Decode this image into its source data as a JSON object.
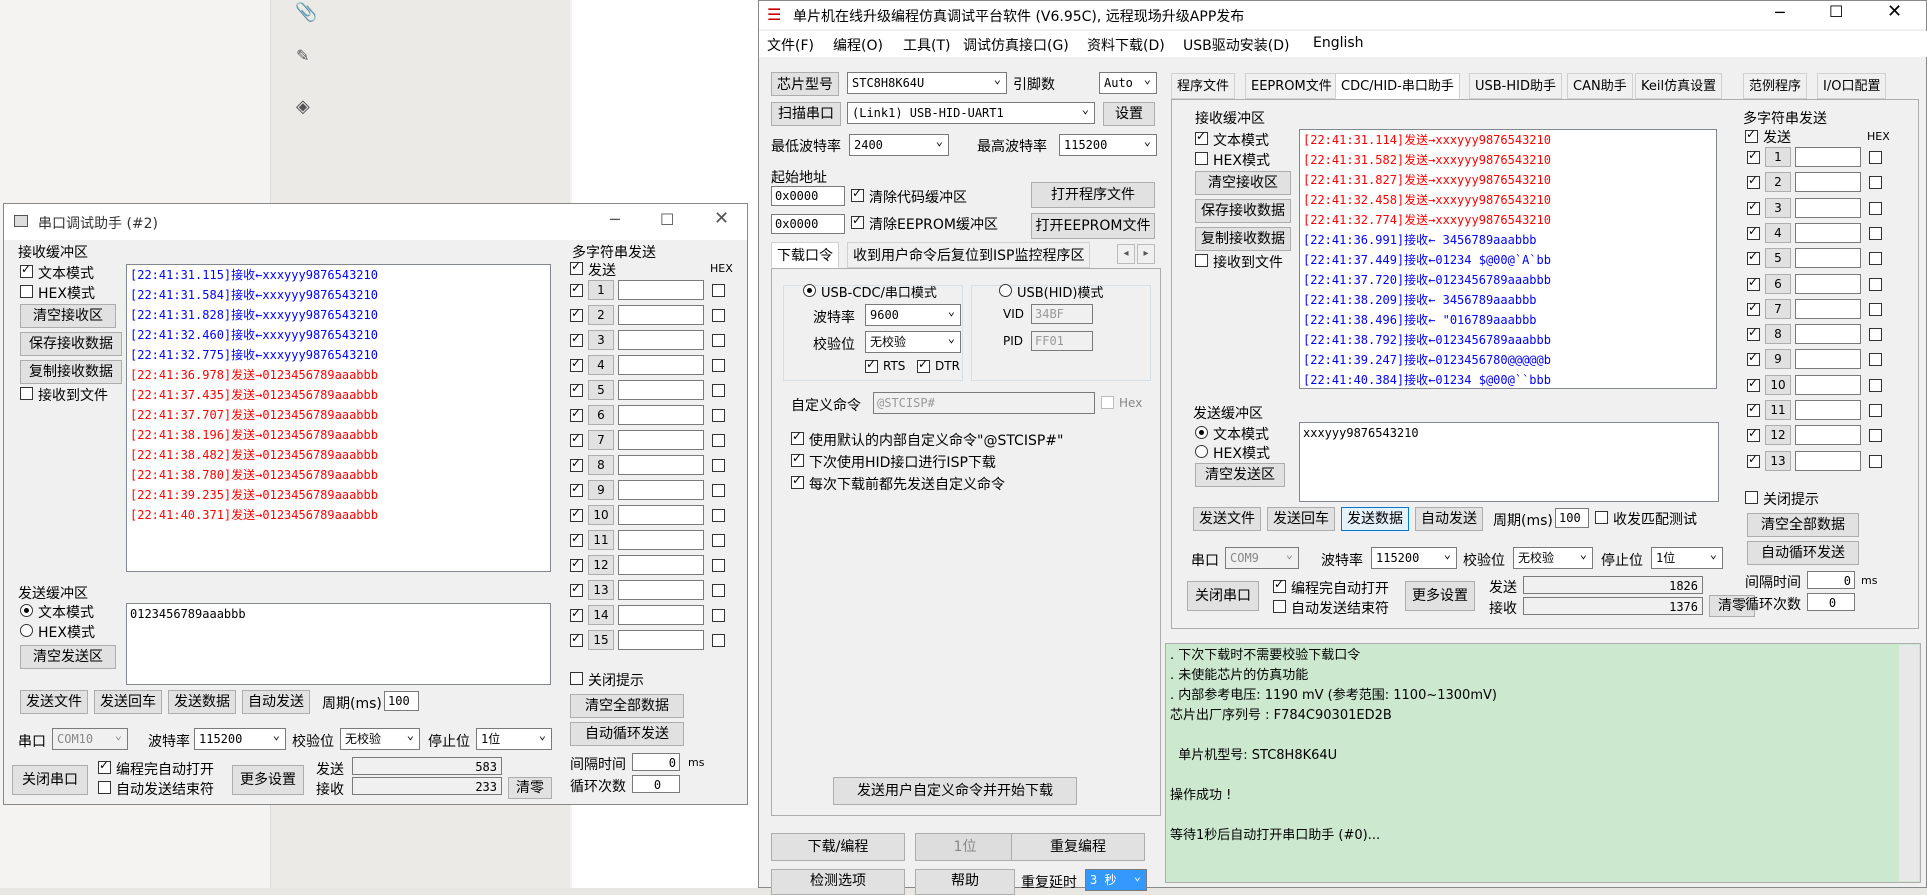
{
  "bg_toolbar": {
    "icons": [
      "paperclip-icon",
      "highlighter-icon",
      "layers-icon"
    ]
  },
  "serial2": {
    "title": "串口调试助手 (#2)",
    "recv_group": "接收缓冲区",
    "text_mode": "文本模式",
    "hex_mode": "HEX模式",
    "clear_recv": "清空接收区",
    "save_recv": "保存接收数据",
    "copy_recv": "复制接收数据",
    "recv_to_file": "接收到文件",
    "log": [
      {
        "t": "[22:41:31.115]接收←xxxyyy9876543210",
        "k": "recv"
      },
      {
        "t": "[22:41:31.584]接收←xxxyyy9876543210",
        "k": "recv"
      },
      {
        "t": "[22:41:31.828]接收←xxxyyy9876543210",
        "k": "recv"
      },
      {
        "t": "[22:41:32.460]接收←xxxyyy9876543210",
        "k": "recv"
      },
      {
        "t": "[22:41:32.775]接收←xxxyyy9876543210",
        "k": "recv"
      },
      {
        "t": "[22:41:36.978]发送→0123456789aaabbb",
        "k": "sent"
      },
      {
        "t": "[22:41:37.435]发送→0123456789aaabbb",
        "k": "sent"
      },
      {
        "t": "[22:41:37.707]发送→0123456789aaabbb",
        "k": "sent"
      },
      {
        "t": "[22:41:38.196]发送→0123456789aaabbb",
        "k": "sent"
      },
      {
        "t": "[22:41:38.482]发送→0123456789aaabbb",
        "k": "sent"
      },
      {
        "t": "[22:41:38.780]发送→0123456789aaabbb",
        "k": "sent"
      },
      {
        "t": "[22:41:39.235]发送→0123456789aaabbb",
        "k": "sent"
      },
      {
        "t": "[22:41:40.371]发送→0123456789aaabbb",
        "k": "sent"
      }
    ],
    "send_group": "发送缓冲区",
    "send_text": "0123456789aaabbb",
    "clear_send": "清空发送区",
    "send_file": "发送文件",
    "send_enter": "发送回车",
    "send_data": "发送数据",
    "auto_send": "自动发送",
    "period_label": "周期(ms)",
    "period": "100",
    "port_label": "串口",
    "port": "COM10",
    "baud_label": "波特率",
    "baud": "115200",
    "parity_label": "校验位",
    "parity": "无校验",
    "stop_label": "停止位",
    "stop": "1位",
    "close_port": "关闭串口",
    "auto_open": "编程完自动打开",
    "auto_end": "自动发送结束符",
    "more": "更多设置",
    "sent_label": "发送",
    "sent_count": "583",
    "recv_label": "接收",
    "recv_count": "233",
    "clear": "清零",
    "multi_title": "多字符串发送",
    "multi_send": "发送",
    "multi_hex": "HEX",
    "multi_rows": [
      "1",
      "2",
      "3",
      "4",
      "5",
      "6",
      "7",
      "8",
      "9",
      "10",
      "11",
      "12",
      "13",
      "14",
      "15"
    ],
    "close_tip": "关闭提示",
    "clear_all": "清空全部数据",
    "auto_loop": "自动循环发送",
    "interval_label": "间隔时间",
    "interval": "0",
    "ms": "ms",
    "loop_label": "循环次数",
    "loop": "0"
  },
  "main": {
    "title": "单片机在线升级编程仿真调试平台软件 (V6.95C), 远程现场升级APP发布",
    "menu": [
      "文件(F)",
      "编程(O)",
      "工具(T)",
      "调试仿真接口(G)",
      "资料下载(D)",
      "USB驱动安装(D)",
      "English"
    ],
    "chip_label": "芯片型号",
    "chip": "STC8H8K64U",
    "pin_label": "引脚数",
    "pin": "Auto",
    "scan": "扫描串口",
    "port": "(Link1) USB-HID-UART1",
    "settings": "设置",
    "min_baud_label": "最低波特率",
    "min_baud": "2400",
    "max_baud_label": "最高波特率",
    "max_baud": "115200",
    "start_addr": "起始地址",
    "addr1": "0x0000",
    "clear_code": "清除代码缓冲区",
    "open_prog": "打开程序文件",
    "addr2": "0x0000",
    "clear_eeprom": "清除EEPROM缓冲区",
    "open_eeprom": "打开EEPROM文件",
    "tabs_left": [
      "下载口令",
      "收到用户命令后复位到ISP监控程序区"
    ],
    "usb_cdc": "USB-CDC/串口模式",
    "usb_hid": "USB(HID)模式",
    "baud_label": "波特率",
    "baud": "9600",
    "vid_label": "VID",
    "vid": "34BF",
    "parity_label": "校验位",
    "parity": "无校验",
    "pid_label": "PID",
    "pid": "FF01",
    "rts": "RTS",
    "dtr": "DTR",
    "custom_label": "自定义命令",
    "custom": "@STCISP#",
    "hex": "Hex",
    "opt1": "使用默认的内部自定义命令\"@STCISP#\"",
    "opt2": "下次使用HID接口进行ISP下载",
    "opt3": "每次下载前都先发送自定义命令",
    "send_custom": "发送用户自定义命令并开始下载",
    "download": "下载/编程",
    "stop": "1位",
    "reprogram": "重复编程",
    "detect": "检测选项",
    "help": "帮助",
    "repeat_delay_label": "重复延时",
    "repeat_delay": "3 秒",
    "tabs_right": [
      "程序文件",
      "EEPROM文件",
      "CDC/HID-串口助手",
      "USB-HID助手",
      "CAN助手",
      "Keil仿真设置",
      "范例程序",
      "I/O口配置"
    ],
    "recv_group": "接收缓冲区",
    "text_mode": "文本模式",
    "hex_mode": "HEX模式",
    "clear_recv": "清空接收区",
    "save_recv": "保存接收数据",
    "copy_recv": "复制接收数据",
    "recv_to_file": "接收到文件",
    "log": [
      {
        "t": "[22:41:31.114]发送→xxxyyy9876543210",
        "k": "sent"
      },
      {
        "t": "[22:41:31.582]发送→xxxyyy9876543210",
        "k": "sent"
      },
      {
        "t": "[22:41:31.827]发送→xxxyyy9876543210",
        "k": "sent"
      },
      {
        "t": "[22:41:32.458]发送→xxxyyy9876543210",
        "k": "sent"
      },
      {
        "t": "[22:41:32.774]发送→xxxyyy9876543210",
        "k": "sent"
      },
      {
        "t": "[22:41:36.991]接收←   3456789aaabbb",
        "k": "recv"
      },
      {
        "t": "[22:41:37.449]接收←01234 $@00@`A`bb",
        "k": "recv"
      },
      {
        "t": "[22:41:37.720]接收←0123456789aaabbb",
        "k": "recv"
      },
      {
        "t": "[22:41:38.209]接收←   3456789aaabbb",
        "k": "recv"
      },
      {
        "t": "[22:41:38.496]接收←    \"016789aaabbb",
        "k": "recv"
      },
      {
        "t": "[22:41:38.792]接收←0123456789aaabbb",
        "k": "recv"
      },
      {
        "t": "[22:41:39.247]接收←0123456780@@@@@b",
        "k": "recv"
      },
      {
        "t": "[22:41:40.384]接收←01234 $@00@``bbb",
        "k": "recv"
      }
    ],
    "send_group": "发送缓冲区",
    "send_text": "xxxyyy9876543210",
    "clear_send": "清空发送区",
    "send_file": "发送文件",
    "send_enter": "发送回车",
    "send_data": "发送数据",
    "auto_send": "自动发送",
    "period_label": "周期(ms)",
    "period": "100",
    "match": "收发匹配测试",
    "port_label": "串口",
    "port2": "COM9",
    "baud2_label": "波特率",
    "baud2": "115200",
    "parity2_label": "校验位",
    "parity2": "无校验",
    "stop_label": "停止位",
    "close_port": "关闭串口",
    "auto_open": "编程完自动打开",
    "auto_end": "自动发送结束符",
    "more": "更多设置",
    "sent_label": "发送",
    "sent_count": "1826",
    "recv_label": "接收",
    "recv_count": "1376",
    "clear": "清零",
    "multi_title": "多字符串发送",
    "multi_send": "发送",
    "multi_hex": "HEX",
    "multi_rows": [
      "1",
      "2",
      "3",
      "4",
      "5",
      "6",
      "7",
      "8",
      "9",
      "10",
      "11",
      "12",
      "13"
    ],
    "close_tip": "关闭提示",
    "clear_all": "清空全部数据",
    "auto_loop": "自动循环发送",
    "interval_label": "间隔时间",
    "interval": "0",
    "ms": "ms",
    "loop_label": "循环次数",
    "loop": "0",
    "status": [
      ". 下次下载时不需要校验下载口令",
      ". 未使能芯片的仿真功能",
      ". 内部参考电压: 1190 mV (参考范围: 1100~1300mV)",
      "芯片出厂序列号 : F784C90301ED2B",
      "",
      "  单片机型号: STC8H8K64U",
      "",
      "操作成功 !",
      "",
      "等待1秒后自动打开串口助手 (#0)..."
    ],
    "colors": {
      "status_bg": "#cce8cf",
      "recv": "#0000ff",
      "sent": "#ff0000"
    }
  }
}
